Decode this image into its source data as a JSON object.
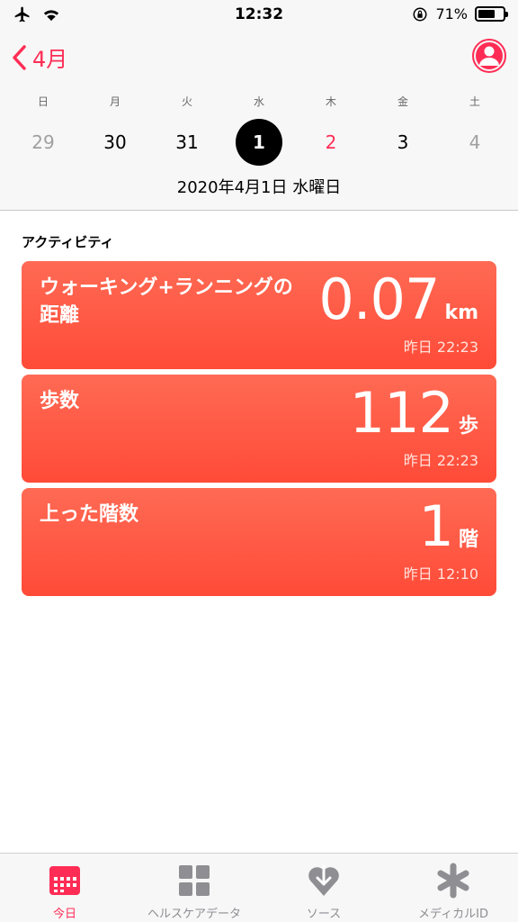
{
  "status_bar": {
    "time": "12:32",
    "battery": "71%",
    "battery_level": 0.71
  },
  "header": {
    "back_label": "4月",
    "weekdays": [
      "日",
      "月",
      "火",
      "水",
      "木",
      "金",
      "土"
    ],
    "dates": [
      "29",
      "30",
      "31",
      "1",
      "2",
      "3",
      "4"
    ],
    "full_date": "2020年4月1日 水曜日"
  },
  "activity": {
    "section_title": "アクティビティ",
    "cards": [
      {
        "title": "ウォーキング+ランニングの距離",
        "value": "0.07",
        "unit": "km",
        "time": "昨日 22:23"
      },
      {
        "title": "歩数",
        "value": "112",
        "unit": "歩",
        "time": "昨日 22:23"
      },
      {
        "title": "上った階数",
        "value": "1",
        "unit": "階",
        "time": "昨日 12:10"
      }
    ]
  },
  "tabbar": {
    "tabs": [
      {
        "label": "今日",
        "icon": "calendar-icon"
      },
      {
        "label": "ヘルスケアデータ",
        "icon": "grid-icon"
      },
      {
        "label": "ソース",
        "icon": "heart-download-icon"
      },
      {
        "label": "メディカルID",
        "icon": "asterisk-icon"
      }
    ]
  },
  "colors": {
    "accent": "#ff2d55",
    "card": "#ff5a45"
  }
}
